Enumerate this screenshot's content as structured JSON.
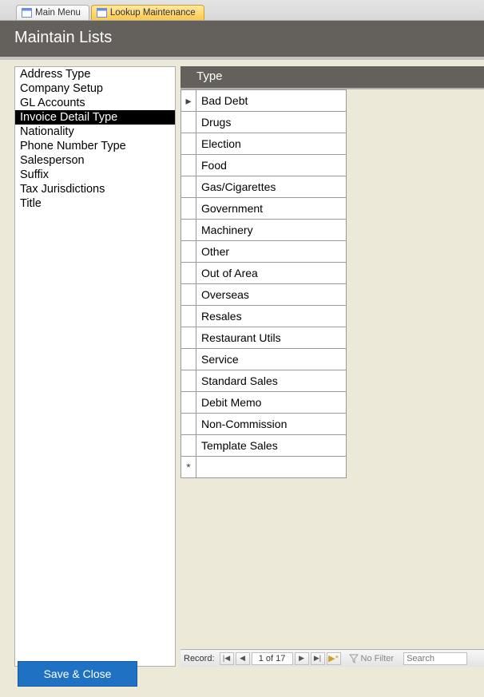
{
  "tabs": [
    {
      "label": "Main Menu",
      "active": false
    },
    {
      "label": "Lookup Maintenance",
      "active": true
    }
  ],
  "header": {
    "title": "Maintain Lists"
  },
  "list": {
    "items": [
      "Address Type",
      "Company Setup",
      "GL Accounts",
      "Invoice Detail Type",
      "Nationality",
      "Phone Number Type",
      "Salesperson",
      "Suffix",
      "Tax Jurisdictions",
      "Title"
    ],
    "selected_index": 3
  },
  "datasheet": {
    "column_header": "Type",
    "rows": [
      "Bad Debt",
      "Drugs",
      "Election",
      "Food",
      "Gas/Cigarettes",
      "Government",
      "Machinery",
      "Other",
      "Out of Area",
      "Overseas",
      "Resales",
      "Restaurant Utils",
      "Service",
      "Standard Sales",
      "Debit Memo",
      "Non-Commission",
      "Template Sales"
    ],
    "current_marker": "▸",
    "new_marker": "*"
  },
  "recnav": {
    "label": "Record:",
    "first": "|◀",
    "prev": "◀",
    "display": "1 of 17",
    "next": "▶",
    "last": "▶|",
    "new": "▶*",
    "filter_label": "No Filter",
    "search_placeholder": "Search"
  },
  "buttons": {
    "save_close": "Save & Close"
  }
}
